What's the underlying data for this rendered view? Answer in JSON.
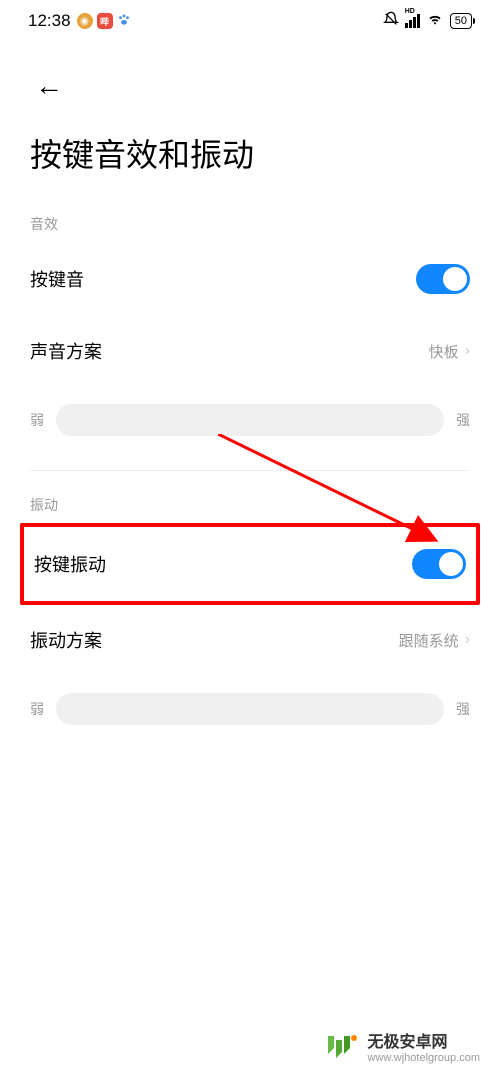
{
  "status_bar": {
    "time": "12:38",
    "battery": "50",
    "icons": {
      "weibo": "weibo",
      "red": "哔",
      "paw": "paw",
      "bell": "bell-muted",
      "signal_hd": "HD",
      "wifi": "wifi"
    }
  },
  "header": {
    "title": "按键音效和振动"
  },
  "sections": {
    "sound": {
      "label": "音效",
      "key_sound": {
        "label": "按键音",
        "enabled": true
      },
      "sound_scheme": {
        "label": "声音方案",
        "value": "快板"
      },
      "slider": {
        "min_label": "弱",
        "max_label": "强"
      }
    },
    "vibration": {
      "label": "振动",
      "key_vibration": {
        "label": "按键振动",
        "enabled": true
      },
      "vibration_scheme": {
        "label": "振动方案",
        "value": "跟随系统"
      },
      "slider": {
        "min_label": "弱",
        "max_label": "强"
      }
    }
  },
  "watermark": {
    "title": "无极安卓网",
    "url": "www.wjhotelgroup.com"
  },
  "annotation": {
    "arrow_color": "#ff0000",
    "highlight_color": "#ff0000"
  }
}
